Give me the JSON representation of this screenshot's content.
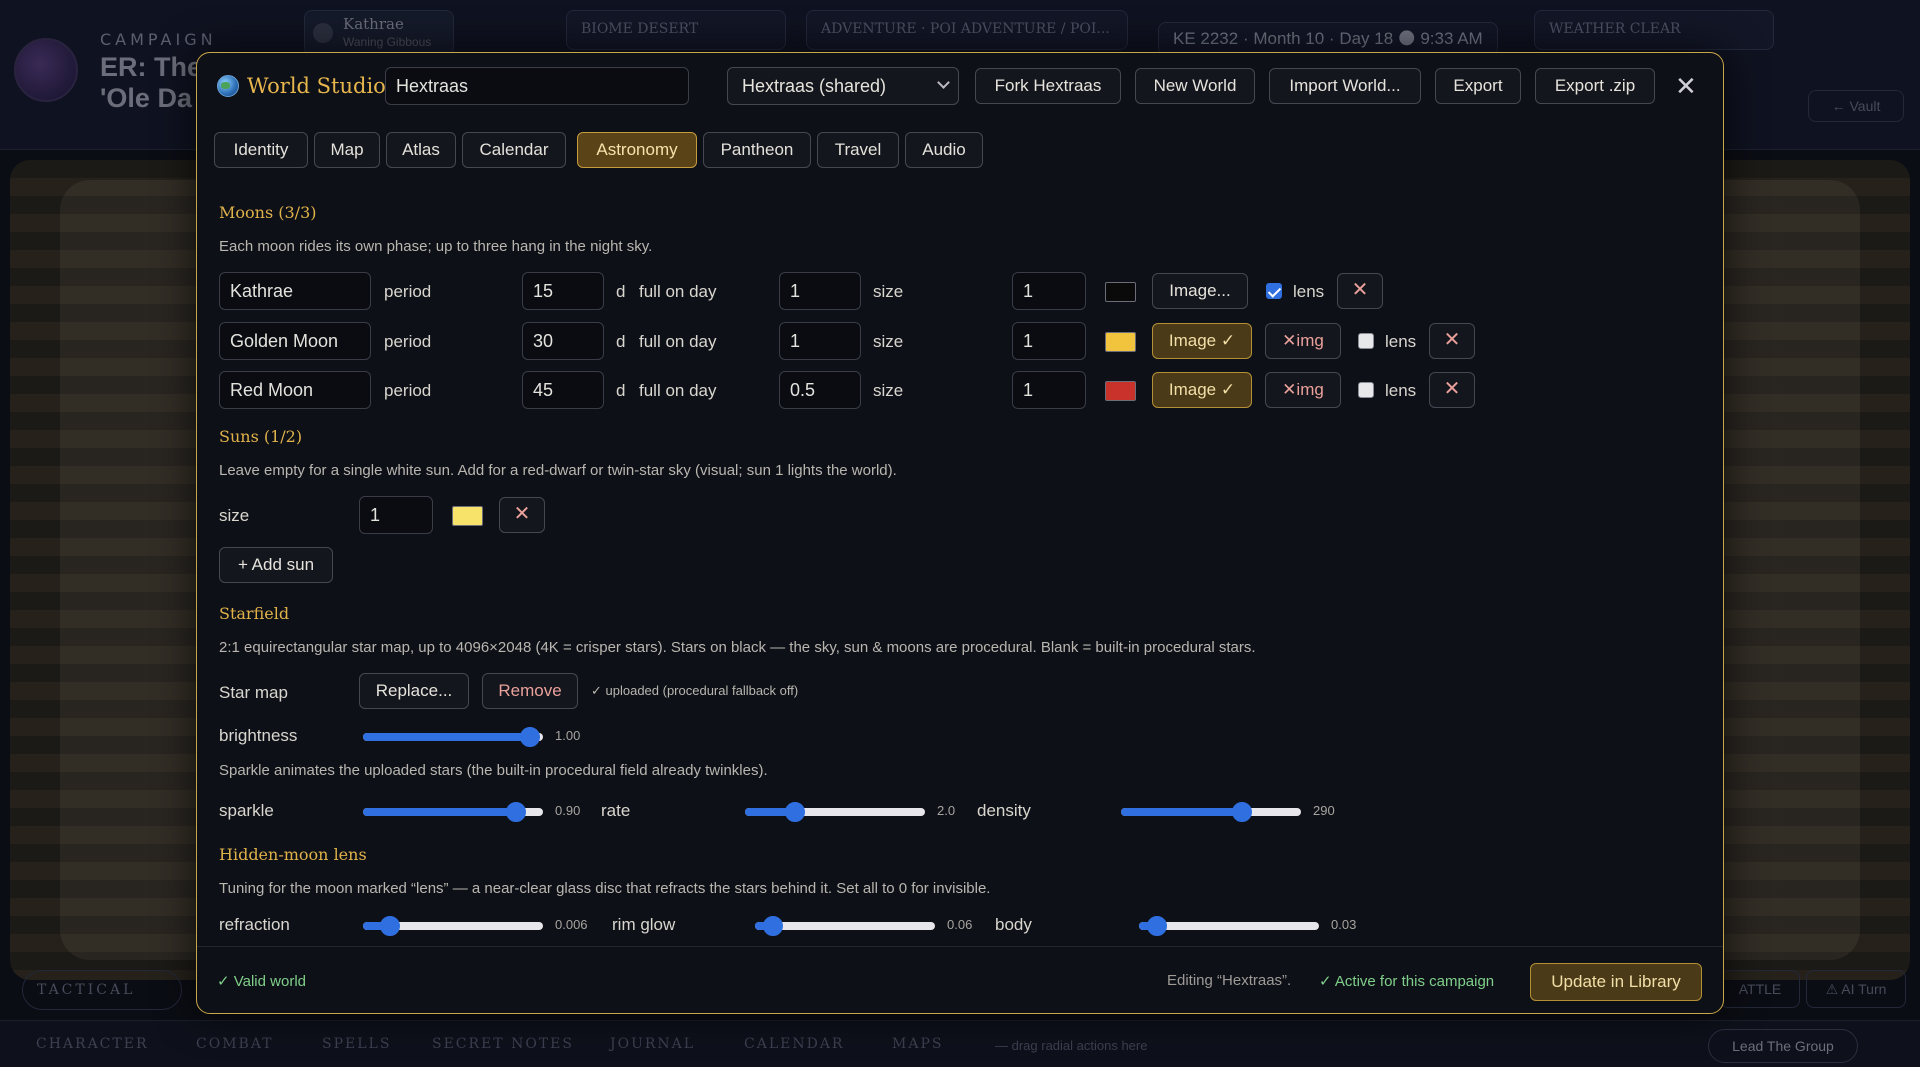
{
  "background": {
    "campaign_label": "CAMPAIGN",
    "campaign_title_line1": "ER: The",
    "campaign_title_line2": "'Ole Da",
    "moon_chip_name": "Kathrae",
    "moon_chip_phase": "Waning Gibbous",
    "biome_chip": "BIOME  DESERT",
    "adventure_chip": "ADVENTURE · POI  ADVENTURE / POI...",
    "datetime": "KE 2232 · Month 10 · Day 18  🌑 9:33 AM",
    "weather_chip": "WEATHER  CLEAR",
    "vault_button": "← Vault",
    "tactical_toggle": "TACTICAL",
    "battle_button": "ATTLE",
    "ai_turn_button": "⚠ AI Turn",
    "lead_group_button": "Lead The Group",
    "drag_hint": "— drag radial actions here",
    "bottom_tabs": [
      "CHARACTER",
      "COMBAT",
      "SPELLS",
      "SECRET NOTES",
      "JOURNAL",
      "CALENDAR",
      "MAPS"
    ]
  },
  "modal": {
    "title": "World Studio",
    "world_name_value": "Hextraas",
    "world_select_value": "Hextraas (shared)",
    "buttons": {
      "fork": "Fork Hextraas",
      "new_world": "New World",
      "import": "Import World...",
      "export": "Export",
      "export_zip": "Export .zip",
      "close": "✕"
    },
    "tabs": [
      "Identity",
      "Map",
      "Atlas",
      "Calendar",
      "Astronomy",
      "Pantheon",
      "Travel",
      "Audio"
    ],
    "active_tab": "Astronomy",
    "moons": {
      "title": "Moons (3/3)",
      "description": "Each moon rides its own phase; up to three hang in the night sky.",
      "period_label": "period",
      "day_unit": "d",
      "full_on_day_label": "full on day",
      "size_label": "size",
      "lens_label": "lens",
      "items": [
        {
          "name": "Kathrae",
          "period": "15",
          "full_on_day": "1",
          "size": "1",
          "color": "#0a0a0a",
          "image_label": "Image...",
          "has_clear_img": false,
          "lens": true
        },
        {
          "name": "Golden Moon",
          "period": "30",
          "full_on_day": "1",
          "size": "1",
          "color": "#f2c43d",
          "image_label": "Image ✓",
          "has_clear_img": true,
          "clear_img_label": "✕img",
          "lens": false
        },
        {
          "name": "Red Moon",
          "period": "45",
          "full_on_day": "0.5",
          "size": "1",
          "color": "#c8322a",
          "image_label": "Image ✓",
          "has_clear_img": true,
          "clear_img_label": "✕img",
          "lens": false
        }
      ],
      "remove_icon": "✕"
    },
    "suns": {
      "title": "Suns (1/2)",
      "description": "Leave empty for a single white sun. Add for a red-dwarf or twin-star sky (visual; sun 1 lights the world).",
      "size_label": "size",
      "size_value": "1",
      "color": "#f7e36a",
      "add_sun": "+ Add sun"
    },
    "starfield": {
      "title": "Starfield",
      "description": "2:1 equirectangular star map, up to 4096×2048 (4K = crisper stars). Stars on black — the sky, sun & moons are procedural. Blank = built-in procedural stars.",
      "star_map_label": "Star map",
      "replace": "Replace...",
      "remove": "Remove",
      "status": "✓ uploaded (procedural fallback off)",
      "brightness_label": "brightness",
      "brightness_value": "1.00",
      "brightness_fraction": 0.93,
      "sparkle_note": "Sparkle animates the uploaded stars (the built-in procedural field already twinkles).",
      "sparkle_label": "sparkle",
      "sparkle_value": "0.90",
      "sparkle_fraction": 0.85,
      "rate_label": "rate",
      "rate_value": "2.0",
      "rate_fraction": 0.28,
      "density_label": "density",
      "density_value": "290",
      "density_fraction": 0.67
    },
    "lens": {
      "title": "Hidden-moon lens",
      "description": "Tuning for the moon marked “lens” — a near-clear glass disc that refracts the stars behind it. Set all to 0 for invisible.",
      "refraction_label": "refraction",
      "refraction_value": "0.006",
      "refraction_fraction": 0.15,
      "rim_glow_label": "rim glow",
      "rim_glow_value": "0.06",
      "rim_glow_fraction": 0.1,
      "body_label": "body",
      "body_value": "0.03",
      "body_fraction": 0.1
    },
    "footer": {
      "valid": "✓ Valid world",
      "editing": "Editing “Hextraas”.",
      "active": "✓ Active for this campaign",
      "update": "Update in Library"
    }
  }
}
